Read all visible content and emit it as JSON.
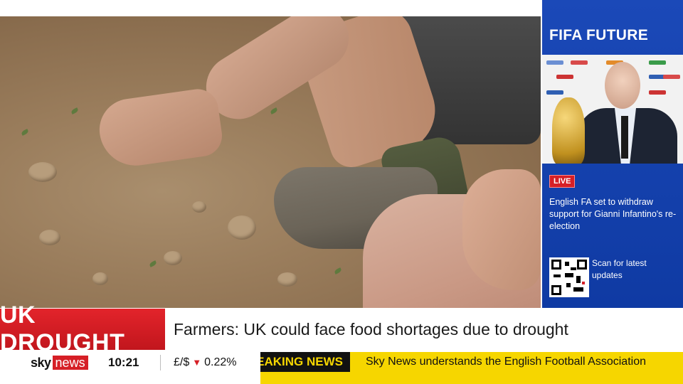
{
  "broadcast": {
    "topic_label": "UK DROUGHT",
    "headline": "Farmers: UK could face food shortages due to drought"
  },
  "side_panel": {
    "title": "FIFA FUTURE",
    "live_label": "LIVE",
    "headline": "English FA set to withdraw support for Gianni Infantino's re-election",
    "qr_text": "Scan for latest updates"
  },
  "footer": {
    "logo_sky": "sky",
    "logo_news": "news",
    "time": "10:21",
    "currency_pair": "£/$",
    "currency_change": "0.22%",
    "currency_direction_icon": "down-triangle-icon",
    "breaking_label": "BREAKING NEWS",
    "ticker_text": "Sky News understands the English Football Association"
  },
  "colors": {
    "brand_red": "#d61f26",
    "ticker_yellow": "#f6d600",
    "panel_blue": "#1b49b8"
  }
}
